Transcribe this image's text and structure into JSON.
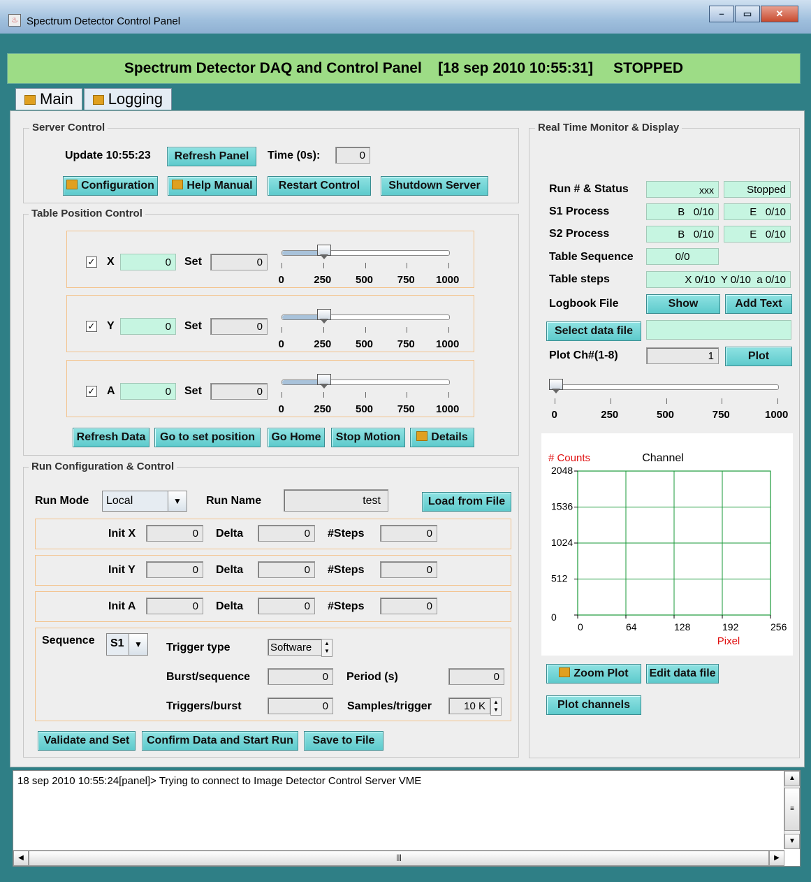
{
  "window": {
    "title": "Spectrum Detector Control Panel"
  },
  "banner": {
    "text": "Spectrum Detector DAQ and Control Panel    [18 sep 2010 10:55:31]     STOPPED"
  },
  "tabs": [
    {
      "label": "Main"
    },
    {
      "label": "Logging"
    }
  ],
  "server_control": {
    "legend": "Server Control",
    "update": "Update 10:55:23",
    "refresh_panel": "Refresh Panel",
    "time_label": "Time (0s):",
    "time_value": "0",
    "configuration": "Configuration",
    "help_manual": "Help Manual",
    "restart_control": "Restart Control",
    "shutdown_server": "Shutdown Server"
  },
  "table_position": {
    "legend": "Table Position Control",
    "set_label": "Set",
    "axes": [
      {
        "name": "X",
        "checked": "✓",
        "value": "0",
        "set": "0",
        "slider": 250
      },
      {
        "name": "Y",
        "checked": "✓",
        "value": "0",
        "set": "0",
        "slider": 250
      },
      {
        "name": "A",
        "checked": "✓",
        "value": "0",
        "set": "0",
        "slider": 250
      }
    ],
    "ticks": [
      "0",
      "250",
      "500",
      "750",
      "1000"
    ],
    "refresh_data": "Refresh Data",
    "go_to_set": "Go to set position",
    "go_home": "Go Home",
    "stop_motion": "Stop Motion",
    "details": "Details"
  },
  "run_config": {
    "legend": "Run Configuration & Control",
    "run_mode_label": "Run Mode",
    "run_mode": "Local",
    "run_name_label": "Run Name",
    "run_name": "test",
    "load_from_file": "Load from File",
    "rows": [
      {
        "init_label": "Init X",
        "init": "0",
        "delta_label": "Delta",
        "delta": "0",
        "steps_label": "#Steps",
        "steps": "0"
      },
      {
        "init_label": "Init Y",
        "init": "0",
        "delta_label": "Delta",
        "delta": "0",
        "steps_label": "#Steps",
        "steps": "0"
      },
      {
        "init_label": "Init A",
        "init": "0",
        "delta_label": "Delta",
        "delta": "0",
        "steps_label": "#Steps",
        "steps": "0"
      }
    ],
    "sequence_label": "Sequence",
    "sequence": "S1",
    "trigger_type_label": "Trigger type",
    "trigger_type": "Software",
    "burst_label": "Burst/sequence",
    "burst": "0",
    "period_label": "Period (s)",
    "period": "0",
    "triggers_label": "Triggers/burst",
    "triggers": "0",
    "samples_label": "Samples/trigger",
    "samples": "10 K",
    "validate": "Validate and Set",
    "confirm": "Confirm Data and Start Run",
    "save": "Save to File"
  },
  "monitor": {
    "legend": "Real Time Monitor & Display",
    "run_status_label": "Run # & Status",
    "run_no": "xxx",
    "status": "Stopped",
    "s1_label": "S1 Process",
    "s1_b": "B   0/10",
    "s1_e": "E   0/10",
    "s2_label": "S2 Process",
    "s2_b": "B   0/10",
    "s2_e": "E   0/10",
    "table_seq_label": "Table Sequence",
    "table_seq": "0/0",
    "table_steps_label": "Table steps",
    "table_steps": "X 0/10  Y 0/10  a 0/10",
    "logbook_label": "Logbook File",
    "show": "Show",
    "add_text": "Add Text",
    "select_data_file": "Select data file",
    "data_file": "",
    "plot_ch_label": "Plot Ch#(1-8)",
    "plot_ch": "1",
    "plot": "Plot",
    "slider_ticks": [
      "0",
      "250",
      "500",
      "750",
      "1000"
    ],
    "zoom_plot": "Zoom Plot",
    "edit_data_file": "Edit data file",
    "plot_channels": "Plot channels"
  },
  "chart_data": {
    "type": "line",
    "title": "Channel",
    "xlabel": "Pixel",
    "ylabel": "# Counts",
    "x_ticks": [
      "0",
      "64",
      "128",
      "192",
      "256"
    ],
    "y_ticks": [
      "0",
      "512",
      "1024",
      "1536",
      "2048"
    ],
    "xlim": [
      0,
      256
    ],
    "ylim": [
      0,
      2048
    ],
    "grid": true,
    "series": [],
    "colors": {
      "grid": "#1a9a3a",
      "label": "#e01010"
    }
  },
  "log": {
    "lines": [
      "18 sep 2010 10:55:24[panel]> Trying to connect to Image Detector Control Server VME"
    ]
  }
}
